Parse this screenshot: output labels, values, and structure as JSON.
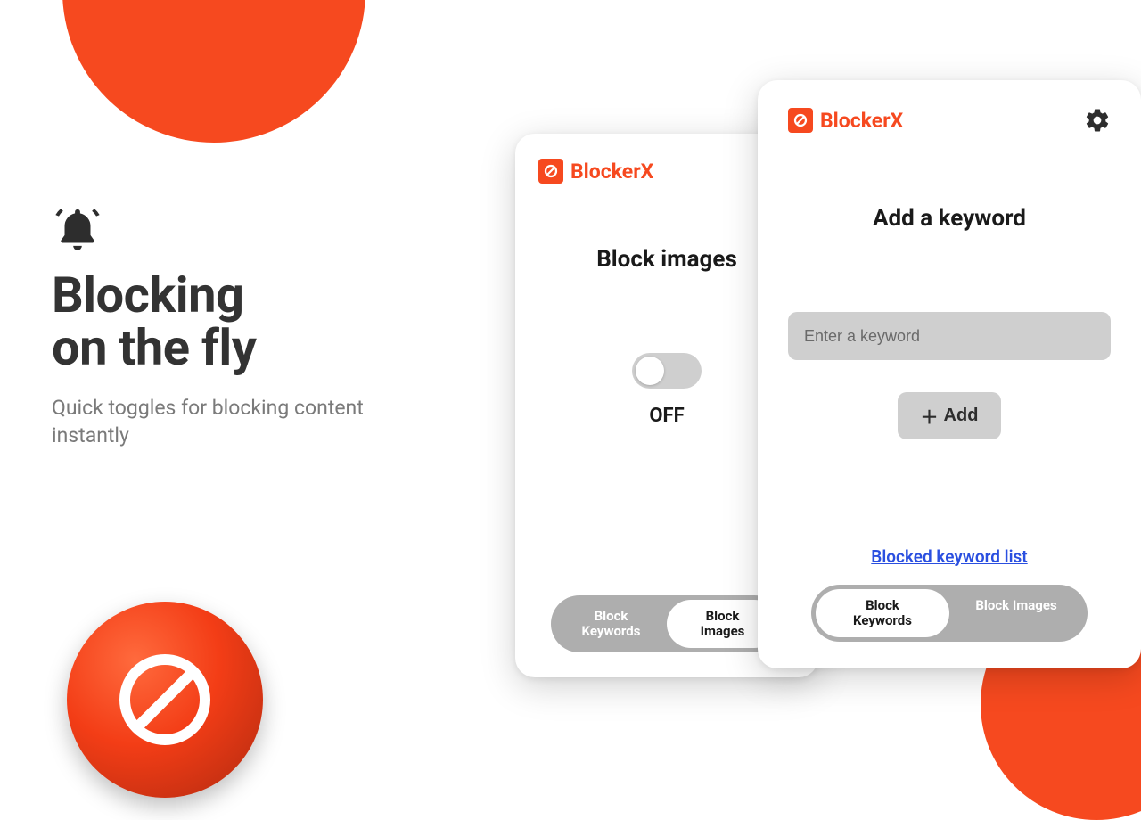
{
  "hero": {
    "title_line1": "Blocking",
    "title_line2": "on the fly",
    "subtitle": "Quick toggles for blocking content instantly"
  },
  "brand": "BlockerX",
  "card_back": {
    "title": "Block images",
    "toggle_state": "OFF",
    "tabs": {
      "keywords": "Block\nKeywords",
      "images": "Block\nImages",
      "active": "images"
    }
  },
  "card_front": {
    "title": "Add a keyword",
    "input_placeholder": "Enter a keyword",
    "add_label": "Add",
    "link_label": "Blocked keyword list",
    "tabs": {
      "keywords": "Block\nKeywords",
      "images": "Block Images",
      "active": "keywords"
    }
  },
  "colors": {
    "accent": "#f6491f"
  }
}
